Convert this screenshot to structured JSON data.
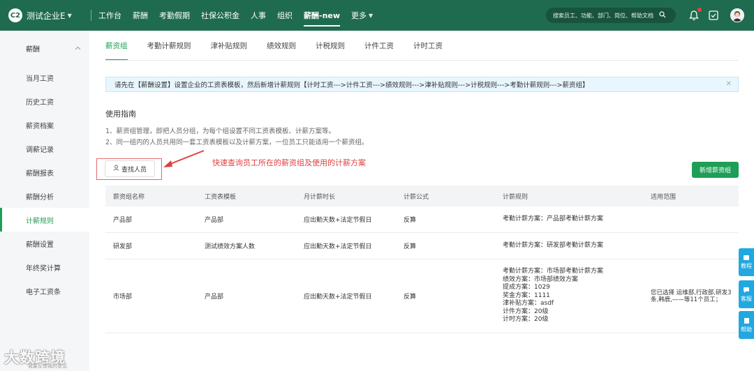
{
  "header": {
    "company": "测试企业E",
    "nav": [
      "工作台",
      "薪酬",
      "考勤假期",
      "社保公积金",
      "人事",
      "组织",
      "薪酬-new",
      "更多"
    ],
    "search_placeholder": "搜索员工、功能、部门、岗位、帮助文档",
    "brand_color": "#1f6b4f"
  },
  "sidebar": {
    "section": "薪酬",
    "items": [
      "当月工资",
      "历史工资",
      "薪资档案",
      "调薪记录",
      "薪酬报表",
      "薪酬分析",
      "计薪规则",
      "薪酬设置",
      "年终奖计算",
      "电子工资条"
    ],
    "active_index": 6
  },
  "tabs": [
    "薪资组",
    "考勤计薪规则",
    "津补贴规则",
    "绩效规则",
    "计税规则",
    "计件工资",
    "计时工资"
  ],
  "notice": "请先在【薪酬设置】设置企业的工资表模板，然后新增计薪规则【计时工资--->计件工资--->绩效规则--->津补贴规则--->计税规则--->考勤计薪规则--->薪资组】",
  "guide": {
    "title": "使用指南",
    "lines": [
      "1、薪资组管理，即把人员分组，为每个组设置不同工资表模板、计薪方案等。",
      "2、同一组内的人员共用同一套工资表模板以及计薪方案，一位员工只能适用一个薪资组。"
    ]
  },
  "buttons": {
    "find": "查找人员",
    "new_group": "新增薪资组"
  },
  "annotation": "快速查询员工所在的薪资组及使用的计薪方案",
  "table": {
    "headers": [
      "薪资组名称",
      "工资表模板",
      "月计薪时长",
      "计薪公式",
      "计薪规则",
      "适用范围"
    ],
    "rows": [
      {
        "name": "产品部",
        "template": "产品部",
        "duration": "应出勤天数+法定节假日",
        "formula": "反算",
        "rules": [
          "考勤计薪方案：产品部考勤计薪方案"
        ],
        "scope": ""
      },
      {
        "name": "研发部",
        "template": "测试绩效方案人数",
        "duration": "应出勤天数+法定节假日",
        "formula": "反算",
        "rules": [
          "考勤计薪方案：研发部考勤计薪方案"
        ],
        "scope": ""
      },
      {
        "name": "市场部",
        "template": "产品部",
        "duration": "应出勤天数+法定节假日",
        "formula": "反算",
        "rules": [
          "考勤计薪方案：市场部考勤计薪方案",
          "绩效方案：市场部绩效方案",
          "提成方案：1029",
          "奖金方案：1111",
          "津补贴方案：asdf",
          "计件方案：20级",
          "计时方案：20级"
        ],
        "scope": "您已选择 运维部,行政部,研发3条,韩鹿,——等11个员工；"
      }
    ]
  },
  "float_panel": [
    "教程",
    "客服",
    "帮助"
  ],
  "watermark": "大数跨境",
  "watermark_sub": "我要反馈我的意见"
}
